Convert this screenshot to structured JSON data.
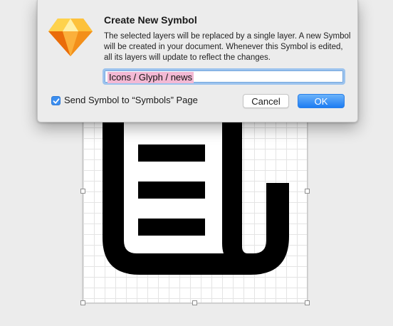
{
  "dialog": {
    "title": "Create New Symbol",
    "message": "The selected layers will be replaced by a single layer. A new Symbol will be created in your document. Whenever this Symbol is edited, all its layers will update to reflect the changes.",
    "symbol_name_value": "Icons / Glyph / news",
    "send_to_page_checked": true,
    "send_to_page_label": "Send Symbol to “Symbols” Page",
    "cancel_label": "Cancel",
    "ok_label": "OK",
    "app_icon": "sketch-diamond-icon"
  },
  "canvas": {
    "glyph_icon": "news-icon"
  },
  "colors": {
    "accent": "#3b8ef0",
    "ok_button": "#1d7cf2",
    "text_selection": "#f3b9d4",
    "sketch_orange": "#f7a823"
  }
}
